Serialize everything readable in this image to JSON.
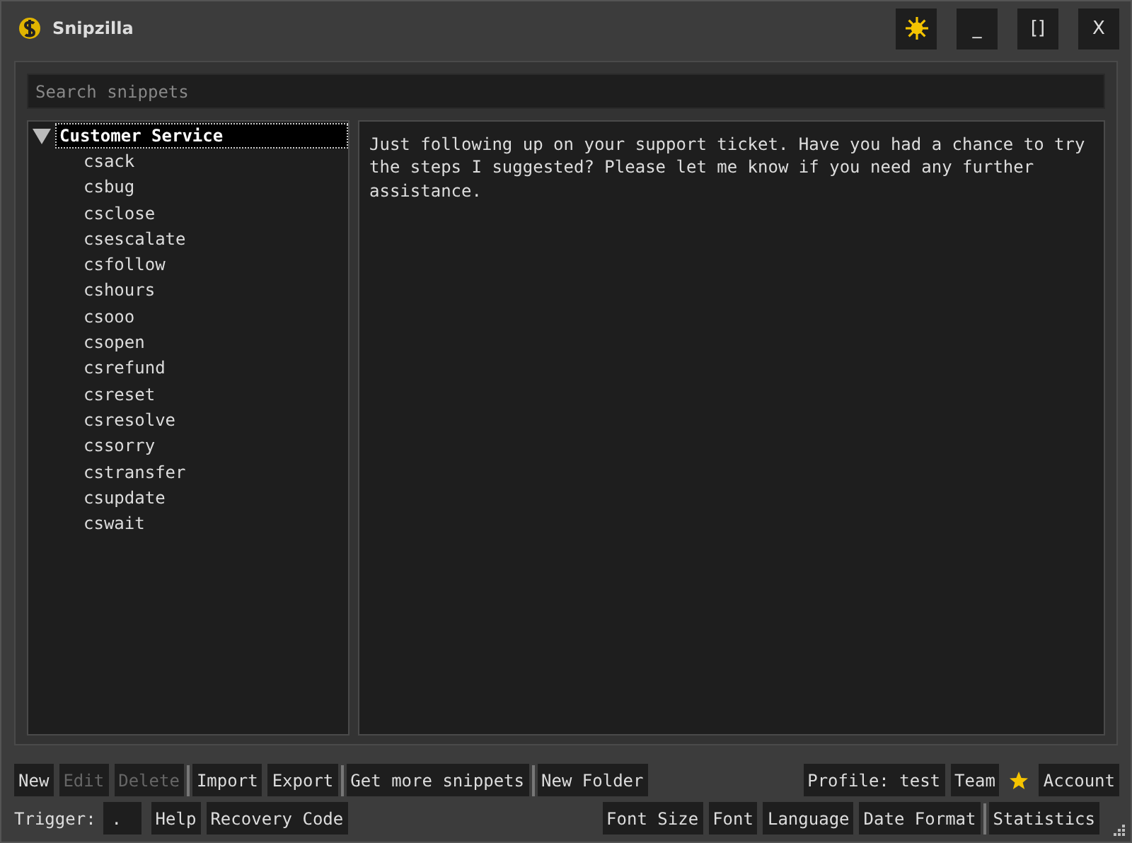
{
  "window": {
    "title": "Snipzilla",
    "controls": [
      "[]",
      "X"
    ],
    "minimize": "_"
  },
  "search": {
    "placeholder": "Search snippets"
  },
  "tree": [
    {
      "label": "Customer Service",
      "expanded": true,
      "selected": true,
      "children": [
        {
          "label": "csack"
        },
        {
          "label": "csbug"
        },
        {
          "label": "csclose"
        },
        {
          "label": "csescalate"
        },
        {
          "label": "csfollow"
        },
        {
          "label": "cshours"
        },
        {
          "label": "csooo"
        },
        {
          "label": "csopen"
        },
        {
          "label": "csrefund"
        },
        {
          "label": "csreset"
        },
        {
          "label": "csresolve"
        },
        {
          "label": "cssorry"
        },
        {
          "label": "cstransfer"
        },
        {
          "label": "csupdate"
        },
        {
          "label": "cswait"
        }
      ]
    }
  ],
  "preview": "Just following up on your support ticket. Have you had a chance to try the steps I suggested? Please let me know if you need any further assistance.",
  "toolbar_top_left": [
    [
      {
        "label": "New",
        "disabled": false
      },
      {
        "label": "Edit",
        "disabled": true
      },
      {
        "label": "Delete",
        "disabled": true
      }
    ],
    [
      {
        "label": "Import",
        "disabled": false
      },
      {
        "label": "Export",
        "disabled": false
      }
    ],
    [
      {
        "label": "Get more snippets",
        "disabled": false
      }
    ],
    [
      {
        "label": "New Folder",
        "disabled": false
      }
    ]
  ],
  "toolbar_top_right": [
    {
      "kind": "button",
      "label": "Profile: test"
    },
    {
      "kind": "button",
      "label": "Team"
    },
    {
      "kind": "star"
    },
    {
      "kind": "button",
      "label": "Account"
    }
  ],
  "trigger": {
    "label": "Trigger:",
    "value": "."
  },
  "toolbar_bottom_left": [
    "Help",
    "Recovery Code"
  ],
  "toolbar_bottom_right": [
    [
      "Font Size",
      "Font",
      "Language",
      "Date Format"
    ],
    [
      "Statistics"
    ]
  ]
}
